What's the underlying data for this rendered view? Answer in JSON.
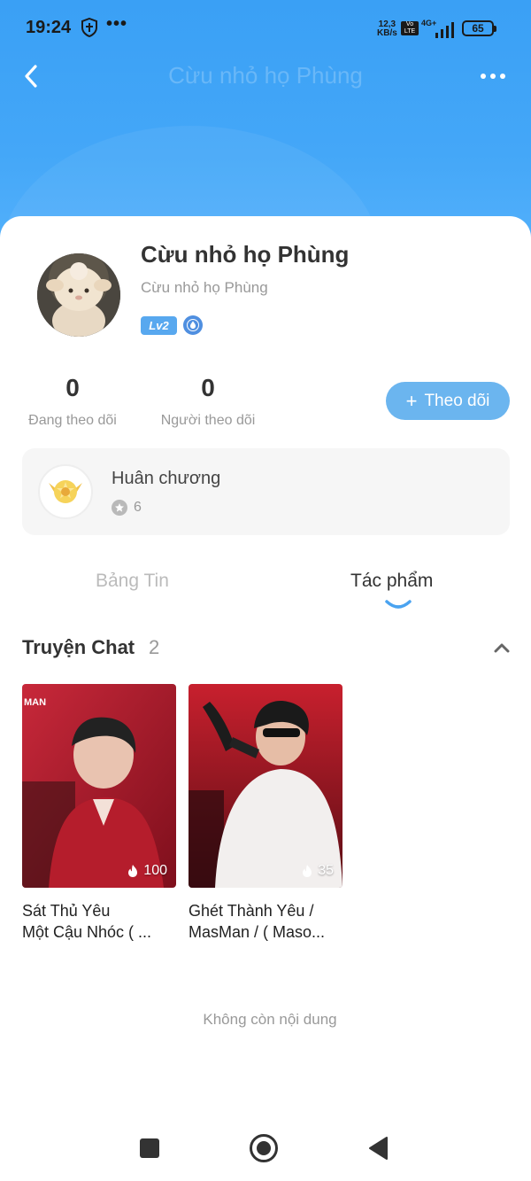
{
  "status_bar": {
    "time": "19:24",
    "dots": "•••",
    "speed_value": "12,3",
    "speed_unit": "KB/s",
    "volte_top": "Vo",
    "volte_bottom": "LTE",
    "network": "4G+",
    "battery": "65"
  },
  "header": {
    "title": "Cừu nhỏ họ Phùng",
    "back_icon": "chevron-left-icon",
    "more_icon": "more-dots-icon"
  },
  "profile": {
    "name": "Cừu nhỏ họ Phùng",
    "subtitle": "Cừu nhỏ họ Phùng",
    "level": "Lv2",
    "avatar_icon": "sheep-plush-avatar"
  },
  "stats": {
    "following_count": "0",
    "following_label": "Đang theo dõi",
    "followers_count": "0",
    "followers_label": "Người theo dõi"
  },
  "follow_button": {
    "plus": "+",
    "label": "Theo dõi",
    "color": "#6bb5ef"
  },
  "medals": {
    "title": "Huân chương",
    "count": "6"
  },
  "tabs": [
    {
      "label": "Bảng Tin",
      "active": false
    },
    {
      "label": "Tác phẩm",
      "active": true
    }
  ],
  "section": {
    "title": "Truyện Chat",
    "count": "2"
  },
  "stories": [
    {
      "title_line1": "Sát Thủ Yêu",
      "title_line2": "Một Cậu Nhóc ( ...",
      "heat": "100",
      "overlay_text": "MAN"
    },
    {
      "title_line1": "Ghét Thành Yêu /",
      "title_line2": "MasMan / ( Maso...",
      "heat": "35"
    }
  ],
  "footer": {
    "end_text": "Không còn nội dung"
  },
  "colors": {
    "header_blue": "#44a7f8",
    "accent": "#58a8ef",
    "text_primary": "#333333",
    "text_secondary": "#999999"
  }
}
